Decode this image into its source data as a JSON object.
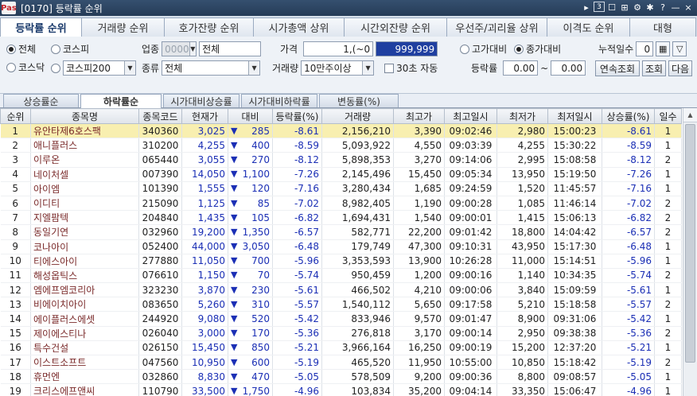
{
  "window": {
    "logo": "Pas",
    "title": "[0170] 등락률 순위",
    "controls": [
      "▸",
      "3",
      "☐",
      "⊞",
      "⚙",
      "✱",
      "?",
      "—",
      "×"
    ]
  },
  "main_tabs": [
    "등락률 순위",
    "거래량 순위",
    "호가잔량 순위",
    "시가총액 상위",
    "시간외잔량 순위",
    "우선주/괴리율 상위",
    "이격도 순위",
    "대형"
  ],
  "filters": {
    "market_all": "전체",
    "kospi": "코스피",
    "kosdaq": "코스닥",
    "kospi200": "코스피200",
    "sector_label": "업종",
    "sector_code": "0000",
    "sector_name": "전체",
    "type_label": "종류",
    "type_value": "전체",
    "price_label": "가격",
    "price_from": "1,(~0",
    "price_to": "999,999",
    "volume_label": "거래량",
    "volume_value": "10만주이상",
    "auto_label": "30초 자동",
    "vs_high": "고가대비",
    "vs_close": "종가대비",
    "rate_label": "등락률",
    "rate_from": "0.00",
    "rate_sep": "~",
    "rate_to": "0.00",
    "cum_days_label": "누적일수",
    "cum_days_value": "0",
    "btn_continuous": "연속조회",
    "btn_query": "조회",
    "btn_next": "다음"
  },
  "sub_tabs": [
    "상승률순",
    "하락률순",
    "시가대비상승률",
    "시가대비하락률",
    "변동률(%)"
  ],
  "columns": [
    "순위",
    "종목명",
    "종목코드",
    "현재가",
    "대비",
    "등락률(%)",
    "거래량",
    "최고가",
    "최고일시",
    "최저가",
    "최저일시",
    "상승률(%)",
    "일수"
  ],
  "rows": [
    [
      "1",
      "유안타제6호스팩",
      "340360",
      "3,025",
      "285",
      "-8.61",
      "2,156,210",
      "3,390",
      "09:02:46",
      "2,980",
      "15:00:23",
      "-8.61",
      "1"
    ],
    [
      "2",
      "애니플러스",
      "310200",
      "4,255",
      "400",
      "-8.59",
      "5,093,922",
      "4,550",
      "09:03:39",
      "4,255",
      "15:30:22",
      "-8.59",
      "1"
    ],
    [
      "3",
      "이루온",
      "065440",
      "3,055",
      "270",
      "-8.12",
      "5,898,353",
      "3,270",
      "09:14:06",
      "2,995",
      "15:08:58",
      "-8.12",
      "2"
    ],
    [
      "4",
      "네이처셀",
      "007390",
      "14,050",
      "1,100",
      "-7.26",
      "2,145,496",
      "15,450",
      "09:05:34",
      "13,950",
      "15:19:50",
      "-7.26",
      "1"
    ],
    [
      "5",
      "아이엠",
      "101390",
      "1,555",
      "120",
      "-7.16",
      "3,280,434",
      "1,685",
      "09:24:59",
      "1,520",
      "11:45:57",
      "-7.16",
      "1"
    ],
    [
      "6",
      "이디티",
      "215090",
      "1,125",
      "85",
      "-7.02",
      "8,982,405",
      "1,190",
      "09:00:28",
      "1,085",
      "11:46:14",
      "-7.02",
      "2"
    ],
    [
      "7",
      "지엘팜텍",
      "204840",
      "1,435",
      "105",
      "-6.82",
      "1,694,431",
      "1,540",
      "09:00:01",
      "1,415",
      "15:06:13",
      "-6.82",
      "2"
    ],
    [
      "8",
      "동일기연",
      "032960",
      "19,200",
      "1,350",
      "-6.57",
      "582,771",
      "22,200",
      "09:01:42",
      "18,800",
      "14:04:42",
      "-6.57",
      "2"
    ],
    [
      "9",
      "코나아이",
      "052400",
      "44,000",
      "3,050",
      "-6.48",
      "179,749",
      "47,300",
      "09:10:31",
      "43,950",
      "15:17:30",
      "-6.48",
      "1"
    ],
    [
      "10",
      "티에스아이",
      "277880",
      "11,050",
      "700",
      "-5.96",
      "3,353,593",
      "13,900",
      "10:26:28",
      "11,000",
      "15:14:51",
      "-5.96",
      "1"
    ],
    [
      "11",
      "해성옵틱스",
      "076610",
      "1,150",
      "70",
      "-5.74",
      "950,459",
      "1,200",
      "09:00:16",
      "1,140",
      "10:34:35",
      "-5.74",
      "2"
    ],
    [
      "12",
      "엠에프엠코리아",
      "323230",
      "3,870",
      "230",
      "-5.61",
      "466,502",
      "4,210",
      "09:00:06",
      "3,840",
      "15:09:59",
      "-5.61",
      "1"
    ],
    [
      "13",
      "비에이치아이",
      "083650",
      "5,260",
      "310",
      "-5.57",
      "1,540,112",
      "5,650",
      "09:17:58",
      "5,210",
      "15:18:58",
      "-5.57",
      "2"
    ],
    [
      "14",
      "에이플러스에셋",
      "244920",
      "9,080",
      "520",
      "-5.42",
      "833,946",
      "9,570",
      "09:01:47",
      "8,900",
      "09:31:06",
      "-5.42",
      "1"
    ],
    [
      "15",
      "제이에스티나",
      "026040",
      "3,000",
      "170",
      "-5.36",
      "276,818",
      "3,170",
      "09:00:14",
      "2,950",
      "09:38:38",
      "-5.36",
      "2"
    ],
    [
      "16",
      "특수건설",
      "026150",
      "15,450",
      "850",
      "-5.21",
      "3,966,164",
      "16,250",
      "09:00:19",
      "15,200",
      "12:37:20",
      "-5.21",
      "1"
    ],
    [
      "17",
      "이스트소프트",
      "047560",
      "10,950",
      "600",
      "-5.19",
      "465,520",
      "11,950",
      "10:55:00",
      "10,850",
      "15:18:42",
      "-5.19",
      "2"
    ],
    [
      "18",
      "휴먼엔",
      "032860",
      "8,830",
      "470",
      "-5.05",
      "578,509",
      "9,200",
      "09:00:36",
      "8,800",
      "09:08:57",
      "-5.05",
      "1"
    ],
    [
      "19",
      "크리스에프앤씨",
      "110790",
      "33,500",
      "1,750",
      "-4.96",
      "103,834",
      "35,200",
      "09:04:14",
      "33,350",
      "15:06:47",
      "-4.96",
      "1"
    ],
    [
      "20",
      "삼보산업",
      "009620",
      "2,310",
      "120",
      "-4.94",
      "12,640,273",
      "2,480",
      "11:02:44",
      "2,200",
      "09:00:08",
      "-4.94",
      "1"
    ]
  ],
  "down_arrow": "▼",
  "colors": {
    "down_blue": "#1b2fb5",
    "name_brown": "#7a2a2a",
    "highlight": "#f8efb0",
    "title_bg": "#263c57"
  }
}
